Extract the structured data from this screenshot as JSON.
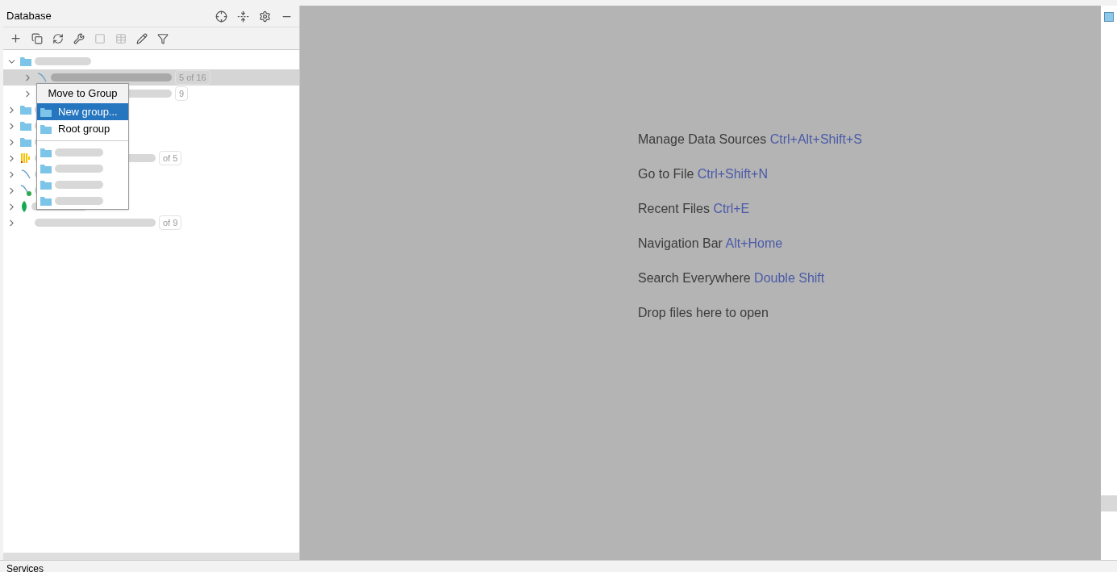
{
  "panel": {
    "title": "Database"
  },
  "tree": [
    {
      "kind": "folder",
      "expanded": true,
      "selected": false,
      "children": [
        {
          "kind": "mysql",
          "expanded": false,
          "selected": true,
          "badge": "5 of 16"
        },
        {
          "kind": "blank",
          "expanded": false,
          "selected": false,
          "badge": "9"
        }
      ]
    },
    {
      "kind": "folder",
      "expanded": false,
      "selected": false
    },
    {
      "kind": "folder",
      "expanded": false,
      "selected": false
    },
    {
      "kind": "folder",
      "expanded": false,
      "selected": false
    },
    {
      "kind": "clickhouse",
      "expanded": false,
      "selected": false,
      "badge": "of 5"
    },
    {
      "kind": "mysql",
      "expanded": false,
      "selected": false
    },
    {
      "kind": "mysql-live",
      "expanded": false,
      "selected": false
    },
    {
      "kind": "mongodb",
      "expanded": false,
      "selected": false
    },
    {
      "kind": "blank",
      "expanded": false,
      "selected": false,
      "badge": "of 9"
    }
  ],
  "menu": {
    "title": "Move to Group",
    "items": [
      {
        "label": "New group...",
        "selected": true
      },
      {
        "label": "Root group",
        "selected": false
      }
    ],
    "more_items": [
      {
        "kind": "folder"
      },
      {
        "kind": "folder"
      },
      {
        "kind": "folder"
      },
      {
        "kind": "folder"
      }
    ]
  },
  "hints": [
    {
      "label": "Manage Data Sources",
      "shortcut": "Ctrl+Alt+Shift+S"
    },
    {
      "label": "Go to File",
      "shortcut": "Ctrl+Shift+N"
    },
    {
      "label": "Recent Files",
      "shortcut": "Ctrl+E"
    },
    {
      "label": "Navigation Bar",
      "shortcut": "Alt+Home"
    },
    {
      "label": "Search Everywhere",
      "shortcut": "Double Shift"
    },
    {
      "label": "Drop files here to open"
    }
  ],
  "bottom_tab": "Services"
}
